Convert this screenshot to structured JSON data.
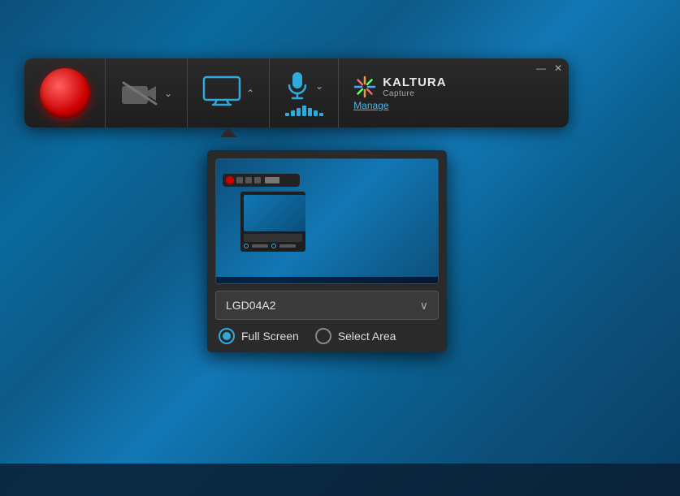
{
  "desktop": {
    "bg_color": "#0a5a8a"
  },
  "toolbar": {
    "record_label": "Record",
    "camera_label": "Camera",
    "screen_label": "Screen",
    "mic_label": "Microphone",
    "kaltura_name": "KALTURA",
    "kaltura_capture": "Capture",
    "manage_label": "Manage",
    "minimize_symbol": "—",
    "close_symbol": "✕"
  },
  "screen_dropdown": {
    "monitor_value": "LGD04A2",
    "monitor_arrow": "∨",
    "fullscreen_label": "Full Screen",
    "select_area_label": "Select Area",
    "fullscreen_selected": true
  },
  "mic_bars": [
    4,
    7,
    10,
    13,
    10,
    7,
    4
  ]
}
